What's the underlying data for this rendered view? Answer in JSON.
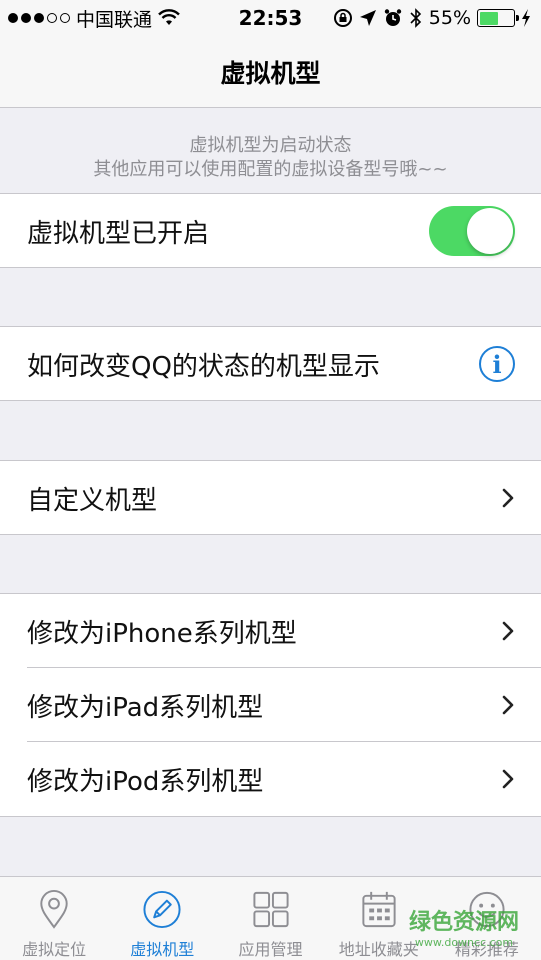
{
  "status_bar": {
    "carrier": "中国联通",
    "time": "22:53",
    "battery_percent": "55%",
    "battery_level": 0.55,
    "signal_filled": 3,
    "signal_total": 5
  },
  "nav": {
    "title": "虚拟机型"
  },
  "notice": {
    "line1": "虚拟机型为启动状态",
    "line2": "其他应用可以使用配置的虚拟设备型号哦~~"
  },
  "rows": {
    "toggle_row": {
      "label": "虚拟机型已开启",
      "on": true
    },
    "qq_row": {
      "label": "如何改变QQ的状态的机型显示"
    },
    "custom_row": {
      "label": "自定义机型"
    },
    "iphone_row": {
      "label": "修改为iPhone系列机型"
    },
    "ipad_row": {
      "label": "修改为iPad系列机型"
    },
    "ipod_row": {
      "label": "修改为iPod系列机型"
    }
  },
  "tabs": [
    {
      "label": "虚拟定位",
      "icon": "location-pin-icon"
    },
    {
      "label": "虚拟机型",
      "icon": "pencil-icon",
      "active": true
    },
    {
      "label": "应用管理",
      "icon": "grid-icon"
    },
    {
      "label": "地址收藏夹",
      "icon": "calendar-icon"
    },
    {
      "label": "精彩推荐",
      "icon": "smiley-icon"
    }
  ],
  "watermark": {
    "text": "绿色资源网",
    "url_text": "www.downcc.com"
  },
  "colors": {
    "accent": "#1e7fd6",
    "toggle_on": "#4cd964"
  }
}
